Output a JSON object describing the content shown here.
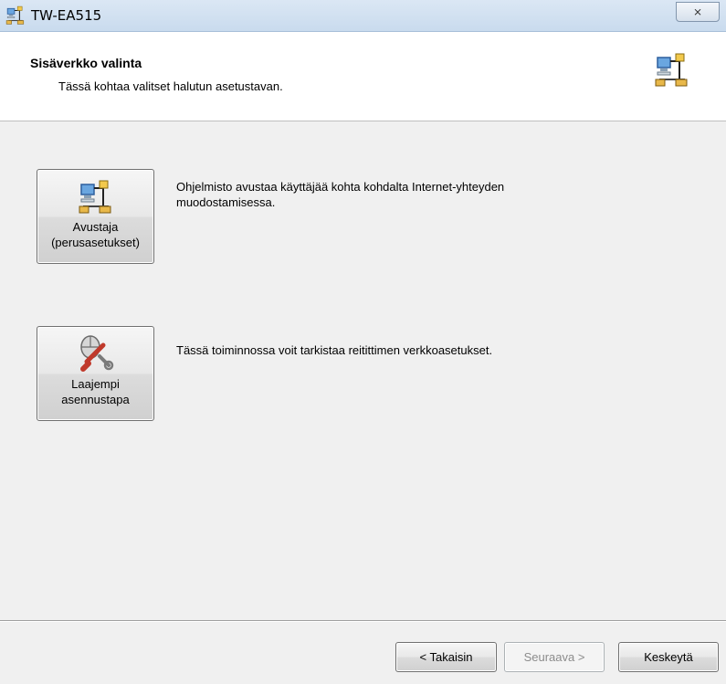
{
  "window": {
    "title": "TW-EA515",
    "close_glyph": "⨯"
  },
  "header": {
    "title": "Sisäverkko valinta",
    "subtitle": "Tässä kohtaa valitset halutun asetustavan.",
    "icon": "network-wizard-icon"
  },
  "options": [
    {
      "label_line1": "Avustaja",
      "label_line2": "(perusasetukset)",
      "icon": "network-wizard-icon",
      "description": "Ohjelmisto avustaa käyttäjää kohta kohdalta Internet-yhteyden muodostamisessa."
    },
    {
      "label_line1": "Laajempi",
      "label_line2": "asennustapa",
      "icon": "wrench-mouse-icon",
      "description": "Tässä toiminnossa voit tarkistaa reitittimen verkkoasetukset."
    }
  ],
  "footer": {
    "back_label": "< Takaisin",
    "next_label": "Seuraava >",
    "cancel_label": "Keskeytä"
  },
  "colors": {
    "titlebar": "#c9dbee",
    "header_bg": "#ffffff",
    "body_bg": "#f0f0f0",
    "disabled_text": "#8c8c8c"
  }
}
